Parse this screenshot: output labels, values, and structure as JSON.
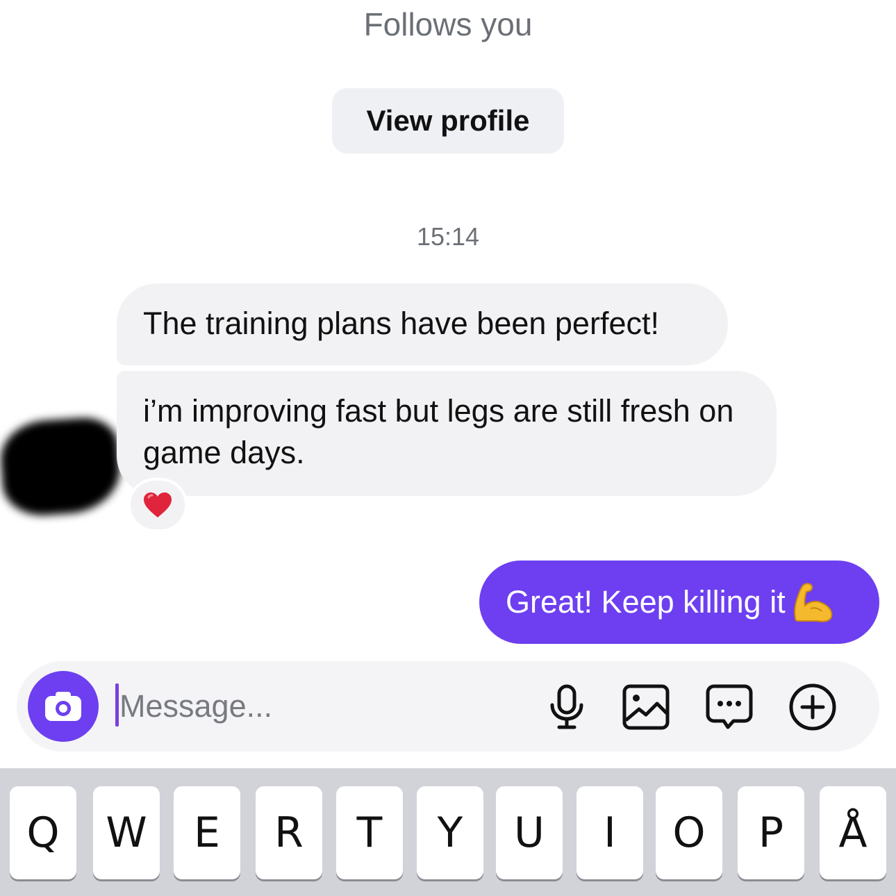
{
  "header": {
    "follows_text": "Follows you",
    "view_profile_label": "View profile"
  },
  "thread": {
    "timestamp": "15:14",
    "incoming": [
      {
        "text": "The training plans have been perfect!"
      },
      {
        "text": "i’m improving fast but legs are still fresh on game days."
      }
    ],
    "reaction": {
      "icon": "red-heart-icon",
      "color": "#e0243c"
    },
    "outgoing": [
      {
        "text": "Great! Keep killing it",
        "emoji_icon": "flexed-biceps-icon"
      }
    ]
  },
  "composer": {
    "placeholder": "Message...",
    "camera_icon": "camera-icon",
    "tools": [
      "microphone-icon",
      "image-icon",
      "chat-bubble-icon",
      "plus-circle-icon"
    ],
    "accent_color": "#6d3ff0"
  },
  "keyboard": {
    "row1": [
      "Q",
      "W",
      "E",
      "R",
      "T",
      "Y",
      "U",
      "I",
      "O",
      "P",
      "Å"
    ]
  },
  "colors": {
    "incoming_bubble": "#f2f2f4",
    "outgoing_bubble": "#6d3ff0",
    "keyboard_bg": "#d1d3d9"
  }
}
